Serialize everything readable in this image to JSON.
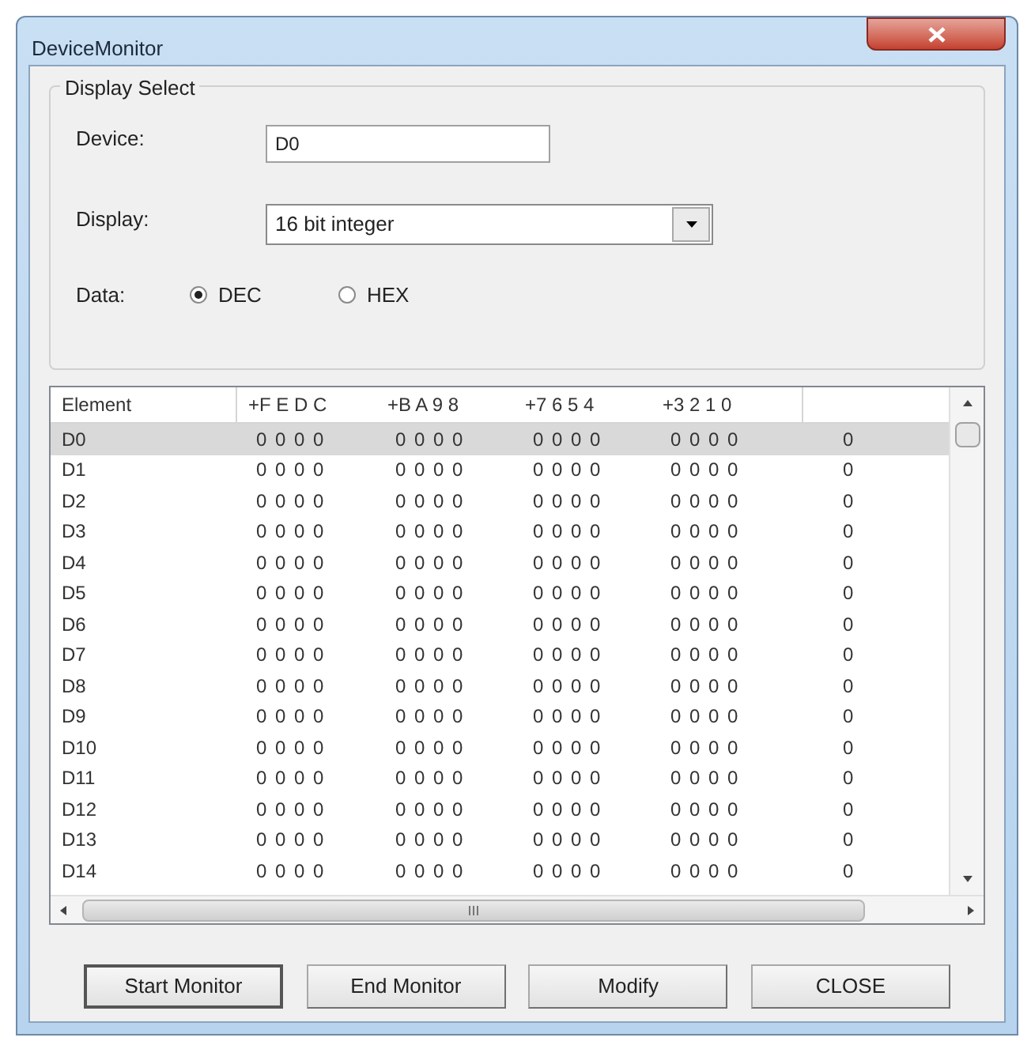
{
  "window": {
    "title": "DeviceMonitor"
  },
  "display_select": {
    "title": "Display Select",
    "device_label": "Device:",
    "device_value": "D0",
    "display_label": "Display:",
    "display_value": "16 bit integer",
    "data_label": "Data:",
    "radios": [
      {
        "label": "DEC",
        "selected": true
      },
      {
        "label": "HEX",
        "selected": false
      }
    ]
  },
  "table": {
    "columns": [
      "Element",
      "+F E D C",
      "+B A 9 8",
      "+7 6 5 4",
      "+3 2 1 0"
    ],
    "rows": [
      {
        "element": "D0",
        "bits": [
          "0 0 0 0",
          "0 0 0 0",
          "0 0 0 0",
          "0 0 0 0"
        ],
        "value": "0",
        "selected": true
      },
      {
        "element": "D1",
        "bits": [
          "0 0 0 0",
          "0 0 0 0",
          "0 0 0 0",
          "0 0 0 0"
        ],
        "value": "0",
        "selected": false
      },
      {
        "element": "D2",
        "bits": [
          "0 0 0 0",
          "0 0 0 0",
          "0 0 0 0",
          "0 0 0 0"
        ],
        "value": "0",
        "selected": false
      },
      {
        "element": "D3",
        "bits": [
          "0 0 0 0",
          "0 0 0 0",
          "0 0 0 0",
          "0 0 0 0"
        ],
        "value": "0",
        "selected": false
      },
      {
        "element": "D4",
        "bits": [
          "0 0 0 0",
          "0 0 0 0",
          "0 0 0 0",
          "0 0 0 0"
        ],
        "value": "0",
        "selected": false
      },
      {
        "element": "D5",
        "bits": [
          "0 0 0 0",
          "0 0 0 0",
          "0 0 0 0",
          "0 0 0 0"
        ],
        "value": "0",
        "selected": false
      },
      {
        "element": "D6",
        "bits": [
          "0 0 0 0",
          "0 0 0 0",
          "0 0 0 0",
          "0 0 0 0"
        ],
        "value": "0",
        "selected": false
      },
      {
        "element": "D7",
        "bits": [
          "0 0 0 0",
          "0 0 0 0",
          "0 0 0 0",
          "0 0 0 0"
        ],
        "value": "0",
        "selected": false
      },
      {
        "element": "D8",
        "bits": [
          "0 0 0 0",
          "0 0 0 0",
          "0 0 0 0",
          "0 0 0 0"
        ],
        "value": "0",
        "selected": false
      },
      {
        "element": "D9",
        "bits": [
          "0 0 0 0",
          "0 0 0 0",
          "0 0 0 0",
          "0 0 0 0"
        ],
        "value": "0",
        "selected": false
      },
      {
        "element": "D10",
        "bits": [
          "0 0 0 0",
          "0 0 0 0",
          "0 0 0 0",
          "0 0 0 0"
        ],
        "value": "0",
        "selected": false
      },
      {
        "element": "D11",
        "bits": [
          "0 0 0 0",
          "0 0 0 0",
          "0 0 0 0",
          "0 0 0 0"
        ],
        "value": "0",
        "selected": false
      },
      {
        "element": "D12",
        "bits": [
          "0 0 0 0",
          "0 0 0 0",
          "0 0 0 0",
          "0 0 0 0"
        ],
        "value": "0",
        "selected": false
      },
      {
        "element": "D13",
        "bits": [
          "0 0 0 0",
          "0 0 0 0",
          "0 0 0 0",
          "0 0 0 0"
        ],
        "value": "0",
        "selected": false
      },
      {
        "element": "D14",
        "bits": [
          "0 0 0 0",
          "0 0 0 0",
          "0 0 0 0",
          "0 0 0 0"
        ],
        "value": "0",
        "selected": false
      }
    ]
  },
  "buttons": [
    {
      "label": "Start Monitor",
      "focused": true
    },
    {
      "label": "End Monitor",
      "focused": false
    },
    {
      "label": "Modify",
      "focused": false
    },
    {
      "label": "CLOSE",
      "focused": false
    }
  ]
}
